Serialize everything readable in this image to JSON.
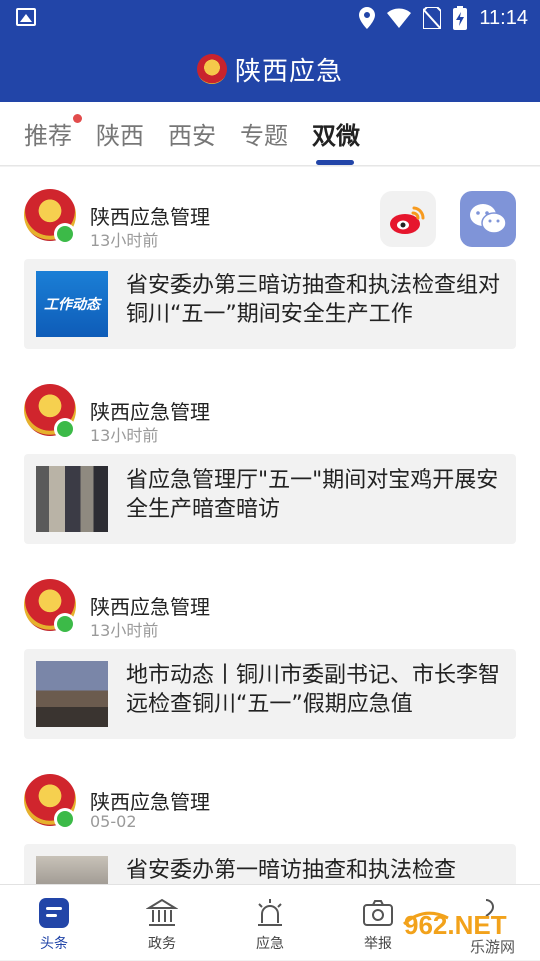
{
  "status_bar": {
    "time": "11:14"
  },
  "app_bar": {
    "title": "陕西应急"
  },
  "tabs": [
    {
      "label": "推荐",
      "has_dot": true
    },
    {
      "label": "陕西"
    },
    {
      "label": "西安"
    },
    {
      "label": "专题"
    },
    {
      "label": "双微",
      "active": true
    }
  ],
  "posts": [
    {
      "author": "陕西应急管理",
      "time": "13小时前",
      "title": "省安委办第三暗访抽查和执法检查组对铜川“五一”期间安全生产工作",
      "thumb_text": "工作动态"
    },
    {
      "author": "陕西应急管理",
      "time": "13小时前",
      "title": "省应急管理厅\"五一\"期间对宝鸡开展安全生产暗查暗访"
    },
    {
      "author": "陕西应急管理",
      "time": "13小时前",
      "title": "地市动态丨铜川市委副书记、市长李智远检查铜川“五一”假期应急值"
    },
    {
      "author": "陕西应急管理",
      "time": "05-02",
      "title": "省安委办第一暗访抽查和执法检查"
    }
  ],
  "bottom_nav": [
    {
      "label": "头条",
      "icon": "headline-icon",
      "active": true
    },
    {
      "label": "政务",
      "icon": "government-building-icon"
    },
    {
      "label": "应急",
      "icon": "alarm-light-icon"
    },
    {
      "label": "举报",
      "icon": "camera-icon"
    },
    {
      "label": "",
      "icon": "more-icon"
    }
  ],
  "watermark": {
    "text": "962.NET",
    "subtext": "乐游网"
  },
  "colors": {
    "primary": "#2245a8",
    "wechat_share": "#7f94d8",
    "weibo_red": "#e6162d",
    "dot": "#e24c4c"
  }
}
